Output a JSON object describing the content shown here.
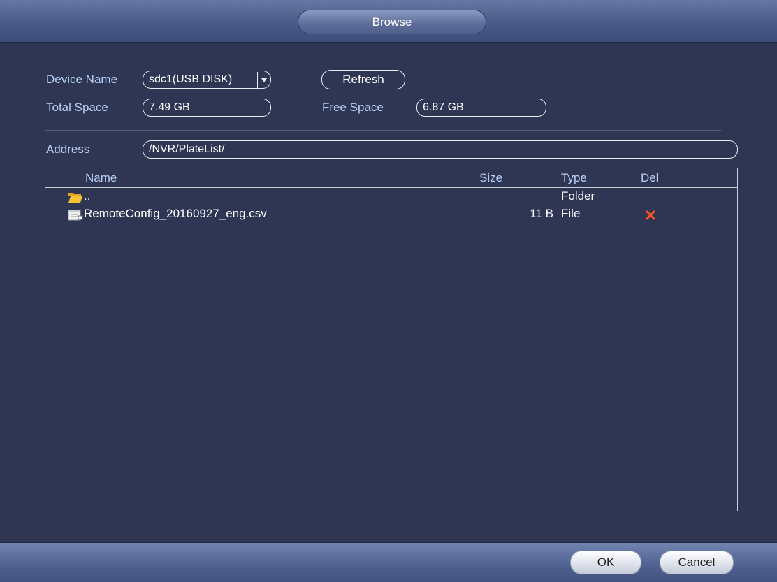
{
  "window": {
    "title": "Browse"
  },
  "device": {
    "name_label": "Device Name",
    "name_value": "sdc1(USB DISK)",
    "refresh_label": "Refresh",
    "total_label": "Total Space",
    "total_value": "7.49 GB",
    "free_label": "Free Space",
    "free_value": "6.87 GB"
  },
  "address": {
    "label": "Address",
    "value": "/NVR/PlateList/"
  },
  "list": {
    "headers": {
      "name": "Name",
      "size": "Size",
      "type": "Type",
      "del": "Del"
    },
    "rows": [
      {
        "name": "..",
        "size": "",
        "type": "Folder",
        "icon": "folder-icon"
      },
      {
        "name": "RemoteConfig_20160927_eng.csv",
        "size": "11 B",
        "type": "File",
        "icon": "file-icon",
        "deletable": true
      }
    ]
  },
  "footer": {
    "ok_label": "OK",
    "cancel_label": "Cancel"
  },
  "colors": {
    "background": "#2e3653",
    "label": "#b9cff7",
    "delete": "#ff5522"
  }
}
